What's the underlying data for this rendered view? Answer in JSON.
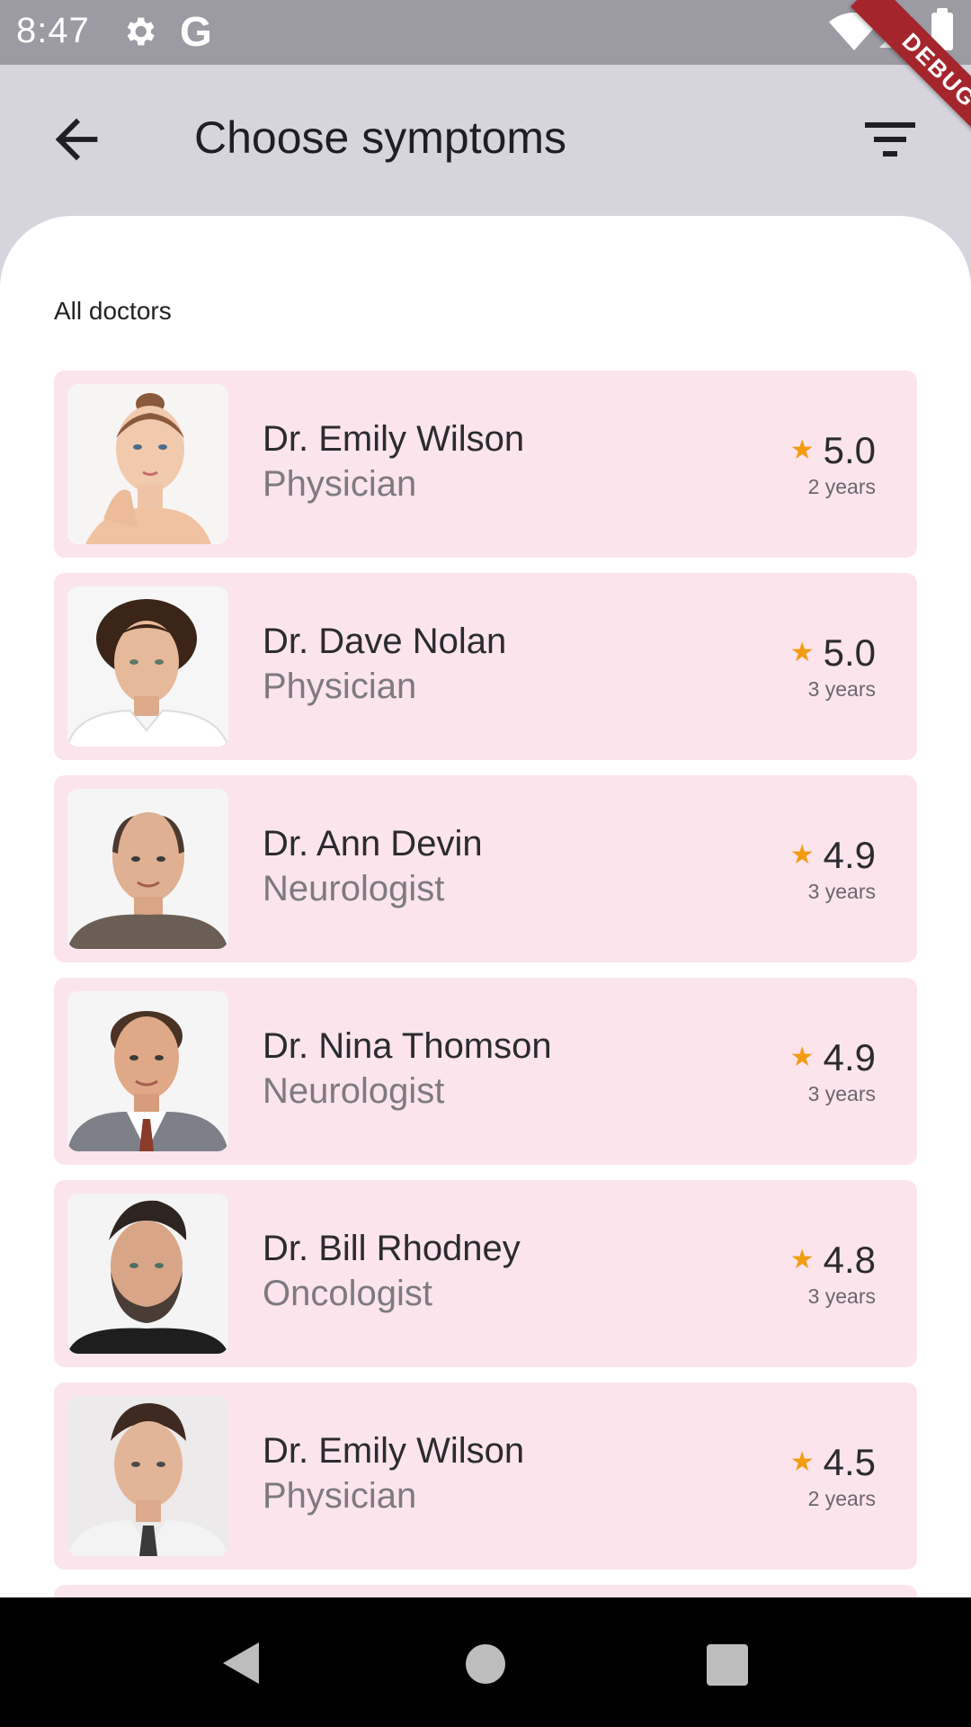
{
  "status_bar": {
    "time": "8:47",
    "g_letter": "G",
    "icons": [
      "gear-icon",
      "google-icon",
      "wifi-icon",
      "signal-icon",
      "battery-icon"
    ]
  },
  "debug_banner": {
    "label": "DEBUG",
    "color": "#a4262c"
  },
  "app_bar": {
    "title": "Choose symptoms",
    "back_icon": "arrow-left-icon",
    "filter_icon": "filter-icon"
  },
  "section": {
    "label": "All doctors"
  },
  "doctors": [
    {
      "name": "Dr. Emily Wilson",
      "specialty": "Physician",
      "rating": "5.0",
      "experience": "2 years",
      "photo": "woman-portrait"
    },
    {
      "name": "Dr. Dave Nolan",
      "specialty": "Physician",
      "rating": "5.0",
      "experience": "3 years",
      "photo": "curly-hair-man-portrait"
    },
    {
      "name": "Dr. Ann Devin",
      "specialty": "Neurologist",
      "rating": "4.9",
      "experience": "3 years",
      "photo": "balding-man-portrait"
    },
    {
      "name": "Dr. Nina Thomson",
      "specialty": "Neurologist",
      "rating": "4.9",
      "experience": "3 years",
      "photo": "man-in-suit-portrait"
    },
    {
      "name": "Dr. Bill Rhodney",
      "specialty": "Oncologist",
      "rating": "4.8",
      "experience": "3 years",
      "photo": "bearded-man-portrait"
    },
    {
      "name": "Dr. Emily Wilson",
      "specialty": "Physician",
      "rating": "4.5",
      "experience": "2 years",
      "photo": "young-man-tie-portrait"
    }
  ],
  "colors": {
    "card_background": "#fce4ec",
    "star": "#f39c12",
    "app_bar_background": "#d6d4dc"
  },
  "nav_bar": {
    "icons": [
      "nav-back-icon",
      "nav-home-icon",
      "nav-recents-icon"
    ]
  }
}
